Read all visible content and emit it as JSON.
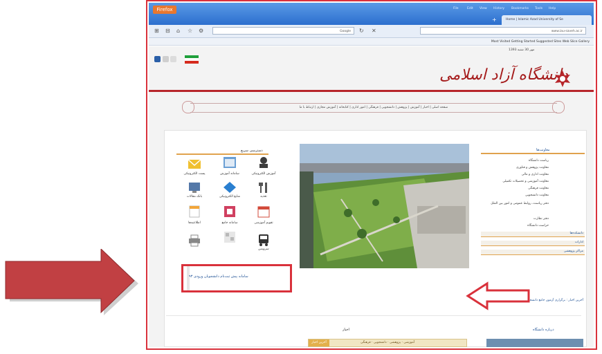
{
  "browser": {
    "firefox_button": "Firefox",
    "menu_items": [
      "File",
      "Edit",
      "View",
      "History",
      "Bookmarks",
      "Tools",
      "Help"
    ],
    "tab_title": "Home | Islamic Azad University of Se",
    "new_tab": "+",
    "url_text": "www.iau-saveh.ac.ir",
    "search_text": "Google",
    "bookmarks_text": "Most Visited  Getting Started  Suggested Sites  Web Slice Gallery"
  },
  "site": {
    "date_text": "1393 مهر 30 شنبه",
    "logo_text": "دانشگاه آزاد اسلامی",
    "menu_strip": "صفحه اصلی  |  اخبار  |  آموزش  |  پژوهش  |  دانشجویی  |  فرهنگی  |  امور اداری  |  کتابخانه  |  آموزش مجازی  |  ارتباط با ما",
    "left_panel_title": "دسترسی سریع",
    "tiles": [
      {
        "label": "آموزش الکترونیکی",
        "icon": "student-icon",
        "color": "#3c3c3c"
      },
      {
        "label": "سامانه آموزش",
        "icon": "window-icon",
        "color": "#6a9fd4"
      },
      {
        "label": "پست الکترونیکی",
        "icon": "mail-icon",
        "color": "#f0c030"
      },
      {
        "label": "تغذیه",
        "icon": "food-icon",
        "color": "#555555"
      },
      {
        "label": "منابع الکترونیکی",
        "icon": "diamond-icon",
        "color": "#2a7fd0"
      },
      {
        "label": "بانک مقالات",
        "icon": "monitor-icon",
        "color": "#5478a8"
      },
      {
        "label": "تقویم آموزشی",
        "icon": "calendar-icon",
        "color": "#d24a3a"
      },
      {
        "label": "سامانه جامع",
        "icon": "shield-icon",
        "color": "#d04060"
      },
      {
        "label": "اطلاعیه‌ها",
        "icon": "document-icon",
        "color": "#f2a63a"
      },
      {
        "label": "سرویس",
        "icon": "bus-icon",
        "color": "#333333"
      },
      {
        "label": "",
        "icon": "grid-icon",
        "color": "#b8b8b8"
      },
      {
        "label": "",
        "icon": "printer-icon",
        "color": "#888888"
      }
    ],
    "highlight_text": "سامانه پیش ثبت‌نام دانشجویان ورودی ۹۳",
    "right_head": "معاونت‌ها",
    "right_items": [
      "ریاست دانشگاه",
      "معاونت پژوهش و فناوری",
      "معاونت اداری و مالی",
      "معاونت آموزشی و تحصیلات تکمیلی",
      "معاونت فرهنگی",
      "معاونت دانشجویی",
      "دفتر ریاست، روابط عمومی و امور بین الملل",
      "دفتر نظارت",
      "حراست دانشگاه"
    ],
    "right_bars": [
      "دانشکده‌ها",
      "ادارات",
      "مراکز پژوهشی"
    ],
    "news_text": "آخرین اخبار : برگزاری آزمون جامع دانشجویان دکتری دانشگاه آزاد اسلامی واحد ساوه",
    "bottom_left_head": "اخبار",
    "bottom_right_head": "درباره دانشگاه",
    "bottom_tabs": [
      "آخرین اخبار",
      "آموزشی",
      "پژوهشی",
      "دانشجویی",
      "فرهنگی"
    ]
  },
  "colors": {
    "frame_red": "#d9313b",
    "brand_red": "#b7262b",
    "orange_line": "#e0a24d",
    "link_blue": "#1b4e93"
  }
}
